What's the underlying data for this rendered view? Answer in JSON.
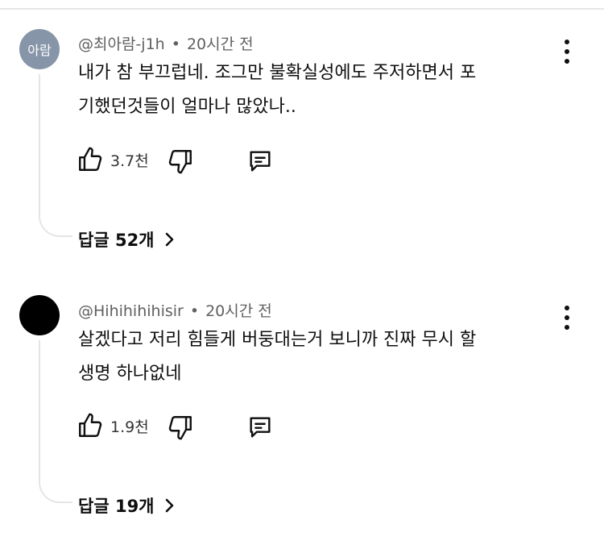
{
  "comments": [
    {
      "avatar_text": "아람",
      "avatar_color": "#8795a8",
      "author": "@최아람-j1h",
      "separator": "•",
      "time": "20시간 전",
      "text_lines": [
        "내가 참 부끄럽네. 조그만 불확실성에도 주저하면서 포",
        "기했던것들이 얼마나 많았나.."
      ],
      "likes": "3.7천",
      "replies": "답글 52개"
    },
    {
      "avatar_text": "",
      "avatar_color": "#000000",
      "author": "@Hihihihihisir",
      "separator": "•",
      "time": "20시간 전",
      "text_lines": [
        "살겠다고 저리 힘들게 버둥대는거 보니까 진짜 무시 할",
        "생명 하나없네"
      ],
      "likes": "1.9천",
      "replies": "답글 19개"
    }
  ],
  "icons": {
    "like": "thumbs-up-icon",
    "dislike": "thumbs-down-icon",
    "reply": "comment-icon",
    "more": "more-vertical-icon",
    "expand": "chevron-right-icon"
  }
}
